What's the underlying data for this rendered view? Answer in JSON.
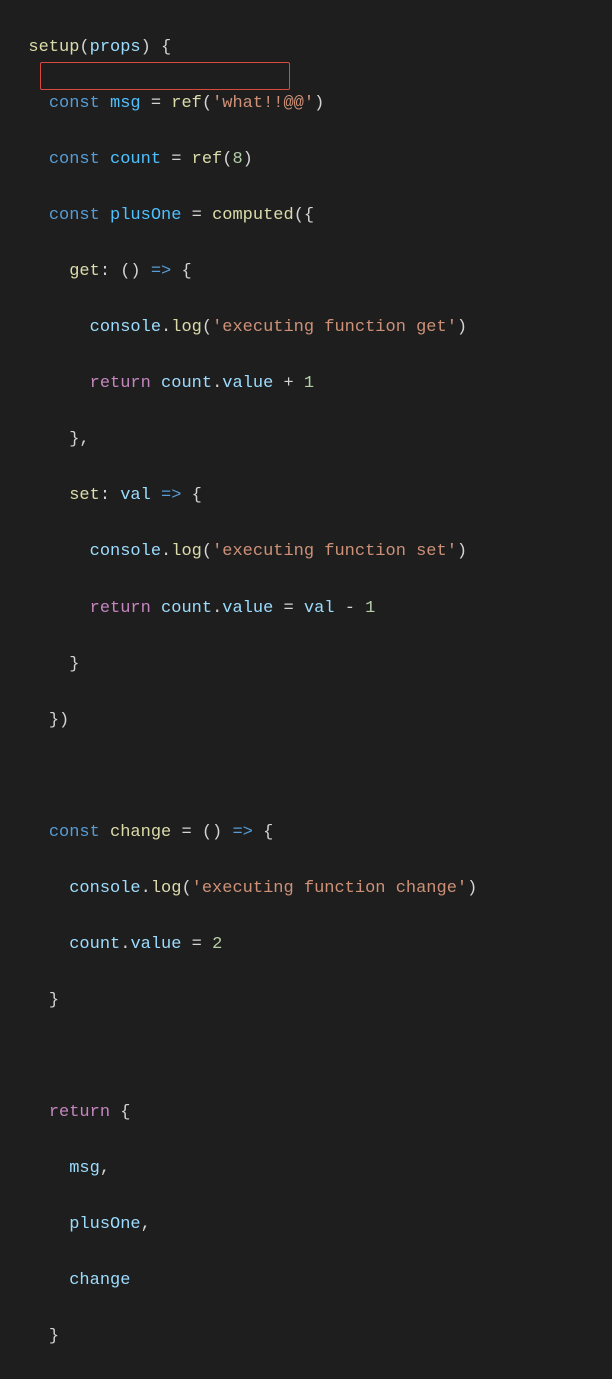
{
  "code": {
    "l1": {
      "fn": "setup",
      "param": "props"
    },
    "l2": {
      "kw": "const",
      "name": "msg",
      "call": "ref",
      "str": "'what!!@@'"
    },
    "l3": {
      "kw": "const",
      "name": "count",
      "call": "ref",
      "num": "8"
    },
    "l4": {
      "kw": "const",
      "name": "plusOne",
      "call": "computed"
    },
    "l5": {
      "prop": "get"
    },
    "l6": {
      "obj": "console",
      "call": "log",
      "str": "'executing function get'"
    },
    "l7": {
      "kw": "return",
      "obj": "count",
      "prop": "value",
      "num": "1"
    },
    "l8": {
      "prop": "set",
      "param": "val"
    },
    "l9": {
      "obj": "console",
      "call": "log",
      "str": "'executing function set'"
    },
    "l10": {
      "kw": "return",
      "obj": "count",
      "prop": "value",
      "var": "val",
      "num": "1"
    },
    "l11": {
      "kw": "const",
      "name": "change"
    },
    "l12": {
      "obj": "console",
      "call": "log",
      "str": "'executing function change'"
    },
    "l13": {
      "obj": "count",
      "prop": "value",
      "num": "2"
    },
    "l14": {
      "kw": "return"
    },
    "l15": {
      "name": "msg"
    },
    "l16": {
      "name": "plusOne"
    },
    "l17": {
      "name": "change"
    }
  }
}
